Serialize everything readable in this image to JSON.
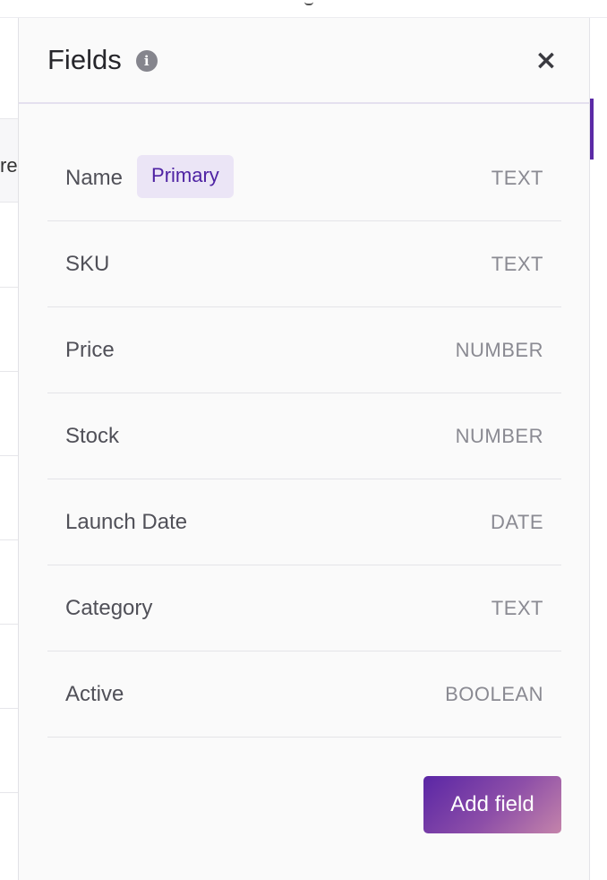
{
  "panel": {
    "title": "Fields",
    "info_glyph": "i",
    "close_glyph": "×"
  },
  "fields": [
    {
      "name": "Name",
      "badge": "Primary",
      "type": "TEXT"
    },
    {
      "name": "SKU",
      "badge": "",
      "type": "TEXT"
    },
    {
      "name": "Price",
      "badge": "",
      "type": "NUMBER"
    },
    {
      "name": "Stock",
      "badge": "",
      "type": "NUMBER"
    },
    {
      "name": "Launch Date",
      "badge": "",
      "type": "DATE"
    },
    {
      "name": "Category",
      "badge": "",
      "type": "TEXT"
    },
    {
      "name": "Active",
      "badge": "",
      "type": "BOOLEAN"
    }
  ],
  "actions": {
    "add_label": "Add field"
  },
  "background": {
    "column_header_fragment": "re"
  },
  "colors": {
    "accent": "#5b2aa6",
    "badge_bg": "#ebe5f6",
    "badge_text": "#4e22a3"
  }
}
